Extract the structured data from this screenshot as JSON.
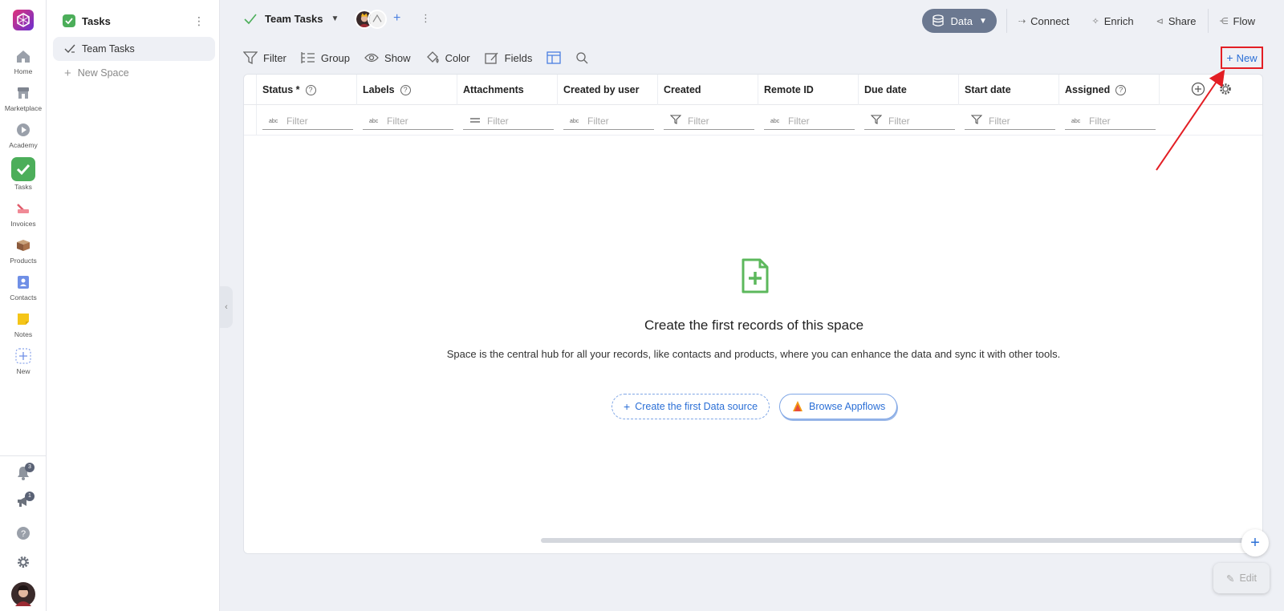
{
  "rail": {
    "items": [
      {
        "label": "Home",
        "icon": "home-icon"
      },
      {
        "label": "Marketplace",
        "icon": "store-icon"
      },
      {
        "label": "Academy",
        "icon": "play-icon"
      },
      {
        "label": "Tasks",
        "icon": "tasks-icon"
      },
      {
        "label": "Invoices",
        "icon": "invoice-icon"
      },
      {
        "label": "Products",
        "icon": "box-icon"
      },
      {
        "label": "Contacts",
        "icon": "contact-card-icon"
      },
      {
        "label": "Notes",
        "icon": "note-icon"
      },
      {
        "label": "New",
        "icon": "add-dashed-icon"
      }
    ],
    "notifications_badge": "3",
    "announcements_badge": "1"
  },
  "sidebar": {
    "title": "Tasks",
    "items": [
      {
        "label": "Team Tasks",
        "active": true
      },
      {
        "label": "New Space",
        "active": false
      }
    ]
  },
  "topbar": {
    "space_name": "Team Tasks",
    "data_label": "Data",
    "connect_label": "Connect",
    "enrich_label": "Enrich",
    "share_label": "Share",
    "flow_label": "Flow"
  },
  "toolbar": {
    "filter_label": "Filter",
    "group_label": "Group",
    "show_label": "Show",
    "color_label": "Color",
    "fields_label": "Fields",
    "new_label": "New"
  },
  "table": {
    "columns": [
      {
        "label": "Status *",
        "help": true,
        "filter_icon": "abc-icon"
      },
      {
        "label": "Labels",
        "help": true,
        "filter_icon": "abc-icon"
      },
      {
        "label": "Attachments",
        "help": false,
        "filter_icon": "equals-icon"
      },
      {
        "label": "Created by user",
        "help": false,
        "filter_icon": "abc-icon"
      },
      {
        "label": "Created",
        "help": false,
        "filter_icon": "funnel-icon"
      },
      {
        "label": "Remote ID",
        "help": false,
        "filter_icon": "abc-icon"
      },
      {
        "label": "Due date",
        "help": false,
        "filter_icon": "funnel-icon"
      },
      {
        "label": "Start date",
        "help": false,
        "filter_icon": "funnel-icon"
      },
      {
        "label": "Assigned",
        "help": true,
        "filter_icon": "abc-icon"
      }
    ],
    "filter_placeholder": "Filter"
  },
  "empty_state": {
    "heading": "Create the first records of this space",
    "description": "Space is the central hub for all your records, like contacts and products, where you can enhance the data and sync it with other tools.",
    "create_label": "Create the first Data source",
    "browse_label": "Browse Appflows"
  },
  "edit_label": "Edit",
  "colors": {
    "accent": "#2b6fd6",
    "highlight": "#e31e24",
    "tasks_green": "#4cae5a",
    "data_pill": "#6b7890"
  }
}
